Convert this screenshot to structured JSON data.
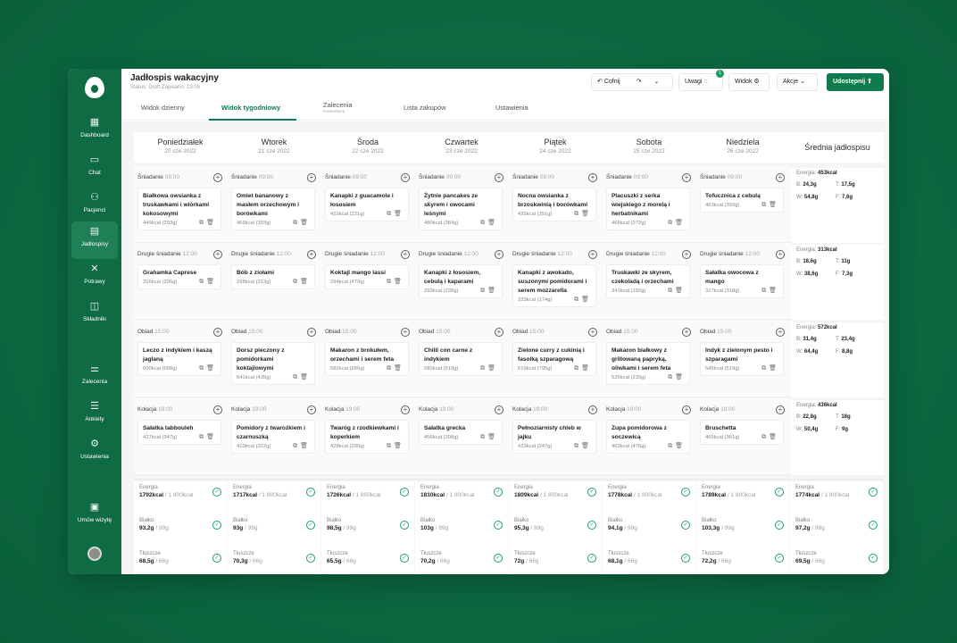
{
  "header": {
    "title": "Jadłospis wakacyjny",
    "subtitle": "Status: Draft   Zapisano: 13:06",
    "undo": "Cofnij",
    "notes": "Uwagi",
    "notes_count": "1",
    "view": "Widok",
    "actions": "Akcje",
    "share": "Udostępnij"
  },
  "sidebar": {
    "items": [
      "Dashboard",
      "Chat",
      "Pacjenci",
      "Jadłospisy",
      "Potrawy",
      "Składniki",
      "Zalecenia",
      "Ankiety",
      "Ustawienia",
      "Umów wizytę"
    ]
  },
  "tabs": {
    "daily": "Widok dzienny",
    "weekly": "Widok tygodniowy",
    "recommendations": "Zalecenia",
    "recommendations_sub": "Komentarze",
    "shopping": "Lista zakupów",
    "settings": "Ustawienia"
  },
  "days": [
    {
      "name": "Poniedziałek",
      "date": "20 cze 2022"
    },
    {
      "name": "Wtorek",
      "date": "21 cze 2022"
    },
    {
      "name": "Środa",
      "date": "22 cze 2022"
    },
    {
      "name": "Czwartek",
      "date": "23 cze 2022"
    },
    {
      "name": "Piątek",
      "date": "24 cze 2022"
    },
    {
      "name": "Sobota",
      "date": "25 cze 2022"
    },
    {
      "name": "Niedziela",
      "date": "26 cze 2022"
    }
  ],
  "avg_title": "Średnia jadłospisu",
  "slots": [
    {
      "name": "Śniadanie",
      "time": "09:00",
      "meals": [
        {
          "name": "Białkowa owsianka z truskawkami i wiórkami kokosowymi",
          "kcal": "449kcal (293g)"
        },
        {
          "name": "Omlet bananowy z masłem orzechowym i borówkami",
          "kcal": "469kcal (303g)"
        },
        {
          "name": "Kanapki z guacamole i łososiem",
          "kcal": "422kcal (221g)"
        },
        {
          "name": "Żytnie pancakes ze skyrem i owocami leśnymi",
          "kcal": "480kcal (384g)"
        },
        {
          "name": "Nocna owsianka z brzoskwinią i borówkami",
          "kcal": "426kcal (351g)"
        },
        {
          "name": "Placuszki z serka wiejskiego z morelą i herbatnikami",
          "kcal": "468kcal (272g)"
        },
        {
          "name": "Tofucznica z cebulą",
          "kcal": "463kcal (393g)"
        }
      ],
      "avg": {
        "energy": "453kcal",
        "b": "24,3g",
        "t": "17,5g",
        "w": "54,8g",
        "f": "7,6g"
      }
    },
    {
      "name": "Drugie śniadanie",
      "time": "12:00",
      "meals": [
        {
          "name": "Grahamka Caprese",
          "kcal": "316kcal (206g)"
        },
        {
          "name": "Bób z ziołami",
          "kcal": "298kcal (313g)"
        },
        {
          "name": "Koktajl mango lassi",
          "kcal": "294kcal (479g)"
        },
        {
          "name": "Kanapki z łososiem, cebulą i kaparami",
          "kcal": "293kcal (235g)"
        },
        {
          "name": "Kanapki z awokado, suszonymi pomidorami i serem mozzarella",
          "kcal": "333kcal (174g)"
        },
        {
          "name": "Truskawki ze skyrem, czekoladą i orzechami",
          "kcal": "341kcal (192g)"
        },
        {
          "name": "Sałatka owocowa z mango",
          "kcal": "317kcal (318g)"
        }
      ],
      "avg": {
        "energy": "313kcal",
        "b": "18,6g",
        "t": "11g",
        "w": "38,6g",
        "f": "7,3g"
      }
    },
    {
      "name": "Obiad",
      "time": "15:00",
      "meals": [
        {
          "name": "Leczo z indykiem i kaszą jaglaną",
          "kcal": "600kcal (668g)"
        },
        {
          "name": "Dorsz pieczony z pomidorkami koktajlowymi",
          "kcal": "541kcal (435g)"
        },
        {
          "name": "Makaron z brokułem, orzechami i serem feta",
          "kcal": "582kcal (286g)"
        },
        {
          "name": "Chilli con carne z indykiem",
          "kcal": "580kcal (519g)"
        },
        {
          "name": "Zielone curry z cukinią i fasolką szparagową",
          "kcal": "619kcal (795g)"
        },
        {
          "name": "Makaron białkowy z grillowaną papryką, oliwkami i serem feta",
          "kcal": "536kcal (230g)"
        },
        {
          "name": "Indyk z zielonym pesto i szparagami",
          "kcal": "545kcal (519g)"
        }
      ],
      "avg": {
        "energy": "572kcal",
        "b": "31,4g",
        "t": "23,4g",
        "w": "64,4g",
        "f": "8,8g"
      }
    },
    {
      "name": "Kolacja",
      "time": "19:00",
      "meals": [
        {
          "name": "Sałatka tabbouleh",
          "kcal": "427kcal (347g)"
        },
        {
          "name": "Pomidory z twarożkiem i czarnuszką",
          "kcal": "410kcal (322g)"
        },
        {
          "name": "Twaróg z rzodkiewkami i koperkiem",
          "kcal": "428kcal (290g)"
        },
        {
          "name": "Sałatka grecka",
          "kcal": "456kcal (398g)"
        },
        {
          "name": "Pełnoziarnisty chleb w jajku",
          "kcal": "433kcal (247g)"
        },
        {
          "name": "Zupa pomidorowa z soczewicą",
          "kcal": "463kcal (476g)"
        },
        {
          "name": "Bruschetta",
          "kcal": "465kcal (361g)"
        }
      ],
      "avg": {
        "energy": "436kcal",
        "b": "22,8g",
        "t": "18g",
        "w": "50,4g",
        "f": "9g"
      }
    }
  ],
  "summary": [
    {
      "energy": "1792kcal",
      "energy_t": "/ 1 800kcal",
      "protein": "93,2g",
      "protein_t": "/ 99g",
      "fat": "68,5g",
      "fat_t": "/ 66g"
    },
    {
      "energy": "1717kcal",
      "energy_t": "/ 1 800kcal",
      "protein": "93g",
      "protein_t": "/ 99g",
      "fat": "70,3g",
      "fat_t": "/ 66g"
    },
    {
      "energy": "1726kcal",
      "energy_t": "/ 1 800kcal",
      "protein": "98,5g",
      "protein_t": "/ 99g",
      "fat": "65,5g",
      "fat_t": "/ 66g"
    },
    {
      "energy": "1810kcal",
      "energy_t": "/ 1 800kcal",
      "protein": "103g",
      "protein_t": "/ 99g",
      "fat": "70,2g",
      "fat_t": "/ 66g"
    },
    {
      "energy": "1809kcal",
      "energy_t": "/ 1 800kcal",
      "protein": "95,3g",
      "protein_t": "/ 99g",
      "fat": "72g",
      "fat_t": "/ 66g"
    },
    {
      "energy": "1778kcal",
      "energy_t": "/ 1 800kcal",
      "protein": "94,1g",
      "protein_t": "/ 99g",
      "fat": "68,1g",
      "fat_t": "/ 66g"
    },
    {
      "energy": "1789kcal",
      "energy_t": "/ 1 800kcal",
      "protein": "103,3g",
      "protein_t": "/ 99g",
      "fat": "72,2g",
      "fat_t": "/ 66g"
    },
    {
      "energy": "1774kcal",
      "energy_t": "/ 1 800kcal",
      "protein": "97,2g",
      "protein_t": "/ 99g",
      "fat": "69,5g",
      "fat_t": "/ 66g"
    }
  ],
  "labels": {
    "energy": "Energia",
    "protein": "Białko",
    "fat": "Tłuszcze",
    "b": "B:",
    "t": "T:",
    "w": "W:",
    "f": "F:",
    "energy_short": "Energia:"
  },
  "colors": {
    "brand": "#0f6b44",
    "accent": "#0f7a4c",
    "ok": "#22a066"
  }
}
